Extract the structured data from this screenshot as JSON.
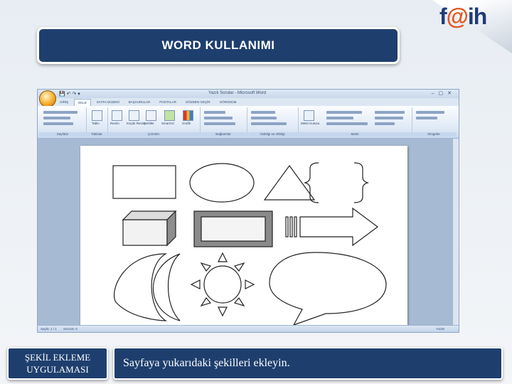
{
  "slide": {
    "title": "WORD KULLANIMI",
    "bottom_label_line1": "ŞEKİL EKLEME",
    "bottom_label_line2": "UYGULAMASI",
    "instruction": "Sayfaya yukarıdaki şekilleri ekleyin."
  },
  "logo": {
    "text_f": "f",
    "text_at": "@",
    "text_ih": "ih",
    "brand_navy": "#1f3c78",
    "brand_orange": "#e2571e"
  },
  "word_window": {
    "title": "Yazılı Sorular - Microsoft Word",
    "tabs": [
      "GİRİŞ",
      "EKLE",
      "SAYFA DÜZENİ",
      "BAŞVURULAR",
      "POSTALAR",
      "GÖZDEN GEÇİR",
      "GÖRÜNÜM"
    ],
    "active_tab": "EKLE",
    "ribbon_groups": [
      "Sayfalar",
      "Tablolar",
      "Çizimler",
      "Bağlantılar",
      "Üstbilgi ve Altbilgi",
      "Metin",
      "Simgeler"
    ],
    "illustration_buttons": [
      "Resim",
      "Küçük Resim",
      "Şekiller",
      "SmartArt",
      "Grafik"
    ],
    "table_button": "Tablo",
    "textbox_button": "Metin Kutusu",
    "status_page": "Sayfa: 1 / 1",
    "status_words": "Sözcük: 0",
    "zoom": "%100"
  },
  "colors": {
    "navy": "#1e3f6e",
    "slide_bg": "#e8edf3"
  }
}
